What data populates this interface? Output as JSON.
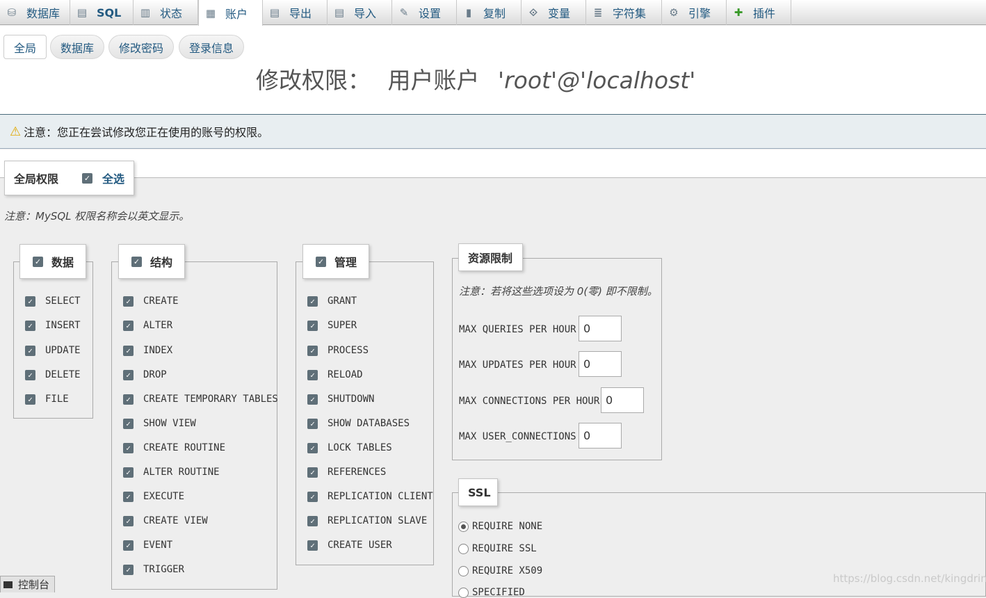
{
  "menu": {
    "tabs": [
      {
        "label": "数据库",
        "icon": "database-icon",
        "glyph": "⛁"
      },
      {
        "label": "SQL",
        "icon": "sql-icon",
        "glyph": "▤"
      },
      {
        "label": "状态",
        "icon": "status-icon",
        "glyph": "▥"
      },
      {
        "label": "账户",
        "icon": "accounts-icon",
        "glyph": "▦",
        "active": true
      },
      {
        "label": "导出",
        "icon": "export-icon",
        "glyph": "▤"
      },
      {
        "label": "导入",
        "icon": "import-icon",
        "glyph": "▤"
      },
      {
        "label": "设置",
        "icon": "wrench-icon",
        "glyph": "✎"
      },
      {
        "label": "复制",
        "icon": "replication-icon",
        "glyph": "▮"
      },
      {
        "label": "变量",
        "icon": "variables-icon",
        "glyph": "⟐"
      },
      {
        "label": "字符集",
        "icon": "charset-icon",
        "glyph": "≣"
      },
      {
        "label": "引擎",
        "icon": "engine-icon",
        "glyph": "⚙"
      },
      {
        "label": "插件",
        "icon": "plugin-icon",
        "glyph": "✚"
      }
    ]
  },
  "subtabs": [
    "全局",
    "数据库",
    "修改密码",
    "登录信息"
  ],
  "title": {
    "prefix": "修改权限：",
    "user_label": "用户账户",
    "account": "'root'@'localhost'"
  },
  "notice": "注意：您正在尝试修改您正在使用的账号的权限。",
  "global": {
    "label": "全局权限",
    "select_all": "全选"
  },
  "mysql_note": "注意：MySQL 权限名称会以英文显示。",
  "groups": {
    "data": {
      "title": "数据",
      "items": [
        "SELECT",
        "INSERT",
        "UPDATE",
        "DELETE",
        "FILE"
      ]
    },
    "structure": {
      "title": "结构",
      "items": [
        "CREATE",
        "ALTER",
        "INDEX",
        "DROP",
        "CREATE TEMPORARY TABLES",
        "SHOW VIEW",
        "CREATE ROUTINE",
        "ALTER ROUTINE",
        "EXECUTE",
        "CREATE VIEW",
        "EVENT",
        "TRIGGER"
      ]
    },
    "admin": {
      "title": "管理",
      "items": [
        "GRANT",
        "SUPER",
        "PROCESS",
        "RELOAD",
        "SHUTDOWN",
        "SHOW DATABASES",
        "LOCK TABLES",
        "REFERENCES",
        "REPLICATION CLIENT",
        "REPLICATION SLAVE",
        "CREATE USER"
      ]
    }
  },
  "resources": {
    "title": "资源限制",
    "note": "注意：若将这些选项设为 0(零) 即不限制。",
    "rows": [
      {
        "label": "MAX QUERIES PER HOUR",
        "value": "0"
      },
      {
        "label": "MAX UPDATES PER HOUR",
        "value": "0"
      },
      {
        "label": "MAX CONNECTIONS PER HOUR",
        "value": "0"
      },
      {
        "label": "MAX USER_CONNECTIONS",
        "value": "0"
      }
    ]
  },
  "ssl": {
    "title": "SSL",
    "options": [
      {
        "label": "REQUIRE NONE",
        "selected": true
      },
      {
        "label": "REQUIRE SSL",
        "selected": false
      },
      {
        "label": "REQUIRE X509",
        "selected": false
      },
      {
        "label": "SPECIFIED",
        "selected": false
      }
    ]
  },
  "console": "控制台",
  "watermark": "https://blog.csdn.net/kingdring"
}
